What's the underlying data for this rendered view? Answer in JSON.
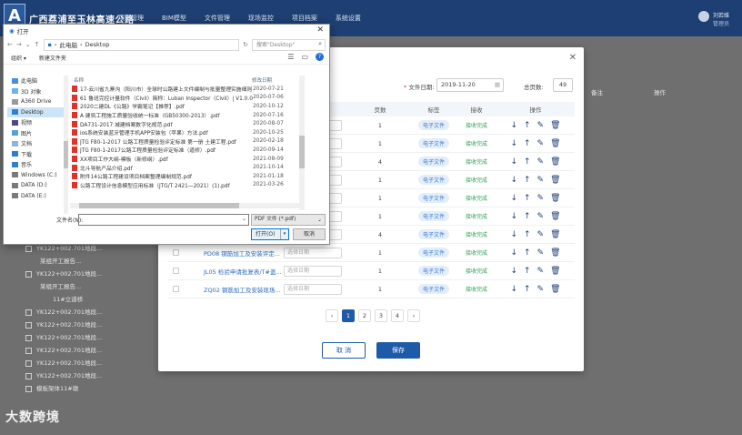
{
  "app": {
    "title": "广西荔浦至玉林高速公路",
    "logo_letter": "A",
    "nav": [
      "项目管理",
      "BIM模型",
      "文件管理",
      "现场监控",
      "项目档案",
      "系统设置"
    ],
    "user": {
      "name": "刘若维",
      "role": "管理员"
    }
  },
  "background": {
    "tree": [
      "YK122+002.701地段...",
      "某组开工报告...",
      "YK122+002.701地段...",
      "某组开工报告...",
      "11#立道桥",
      "YK122+002.701地段...",
      "YK122+002.701地段...",
      "YK122+002.701地段...",
      "YK122+002.701地段...",
      "YK122+002.701地段...",
      "YK122+002.701地段...",
      "模板架体11#墩"
    ],
    "right_headers": [
      "备注",
      "操作"
    ],
    "watermark": "大数跨境"
  },
  "modal": {
    "file_date_label": "文件日期:",
    "file_date_value": "2019-11-20",
    "pages_label": "总页数:",
    "pages_value": "49",
    "headers": {
      "pages": "页数",
      "tag": "标签",
      "status": "接收",
      "ops": "操作"
    },
    "rows": [
      {
        "name": "",
        "pages": "1",
        "tag": "电子文件",
        "status": "接收完成"
      },
      {
        "name": "",
        "pages": "1",
        "tag": "电子文件",
        "status": "接收完成"
      },
      {
        "name": "",
        "pages": "4",
        "tag": "电子文件",
        "status": "接收完成"
      },
      {
        "name": "",
        "pages": "1",
        "tag": "电子文件",
        "status": "接收完成"
      },
      {
        "name": "",
        "pages": "1",
        "tag": "电子文件",
        "status": "接收完成"
      },
      {
        "name": "",
        "pages": "1",
        "tag": "电子文件",
        "status": "接收完成"
      },
      {
        "name": "",
        "pages": "4",
        "tag": "电子文件",
        "status": "接收完成"
      },
      {
        "name": "PD08 钢筋加工及安装评定...",
        "pages": "1",
        "tag": "电子文件",
        "status": "接收完成"
      },
      {
        "name": "JL05 检验申请批复表/T#盖...",
        "pages": "1",
        "tag": "电子文件",
        "status": "接收完成"
      },
      {
        "name": "ZQ02 钢筋加工及安装现场...",
        "pages": "1",
        "tag": "电子文件",
        "status": "接收完成"
      }
    ],
    "date_placeholder": "选择日期",
    "side_note": "没有预览",
    "pager": [
      "1",
      "2",
      "3",
      "4"
    ],
    "cancel": "取 消",
    "save": "保存"
  },
  "file_dialog": {
    "title": "打开",
    "path": [
      "此电脑",
      "Desktop"
    ],
    "search_placeholder": "搜索\"Desktop\"",
    "organize": "组织 ▾",
    "new_folder": "新建文件夹",
    "nav_items": [
      "此电脑",
      "3D 对象",
      "A360 Drive",
      "Desktop",
      "视频",
      "图片",
      "文档",
      "下载",
      "音乐",
      "Windows (C:)",
      "DATA (D:)",
      "DATA (E:)"
    ],
    "col_name": "名称",
    "col_date": "修改日期",
    "files": [
      {
        "name": "17-云川省九寨沟（阳川市）全球时公路建上文件编制与批量整理实施细则（20200402...",
        "date": "2020-07-21"
      },
      {
        "name": "61 鲁班完控计量软件（Civil）简称：Luban Inspector（Civil）| V1.0.0.pdf",
        "date": "2020-07-06"
      },
      {
        "name": "2020二建DL《公路》学霸笔记【推荐】.pdf",
        "date": "2020-10-12"
      },
      {
        "name": "A 建筑工程施工质量验收统一标准（GB50300-2013）.pdf",
        "date": "2020-07-16"
      },
      {
        "name": "DA731-2017 城建档案数字化规范.pdf",
        "date": "2020-08-07"
      },
      {
        "name": "ios系统安装蓝牙管理手机APP安装包（苹果）方法.pdf",
        "date": "2020-10-25"
      },
      {
        "name": "JTG F80-1-2017 公路工程质量检验评定标准 第一册 土建工程.pdf",
        "date": "2020-02-18"
      },
      {
        "name": "JTG F80-1-2017公路工程质量检验评定标准（道桥）.pdf",
        "date": "2020-09-14"
      },
      {
        "name": "XX项目工作大纲-模板（新修纲）.pdf",
        "date": "2021-08-09"
      },
      {
        "name": "北斗导航产品介绍.pdf",
        "date": "2021-10-14"
      },
      {
        "name": "附件14公路工程建设项目档案整理编制规范.pdf",
        "date": "2021-01-18"
      },
      {
        "name": "公路工程设计信息模型应用标准（JTG/T 2421—2021）(1).pdf",
        "date": "2021-03-26"
      }
    ],
    "filename_label": "文件名(N):",
    "filename_value": "",
    "filetype": "PDF 文件 (*.pdf)",
    "open": "打开(O)",
    "cancel": "取消"
  }
}
